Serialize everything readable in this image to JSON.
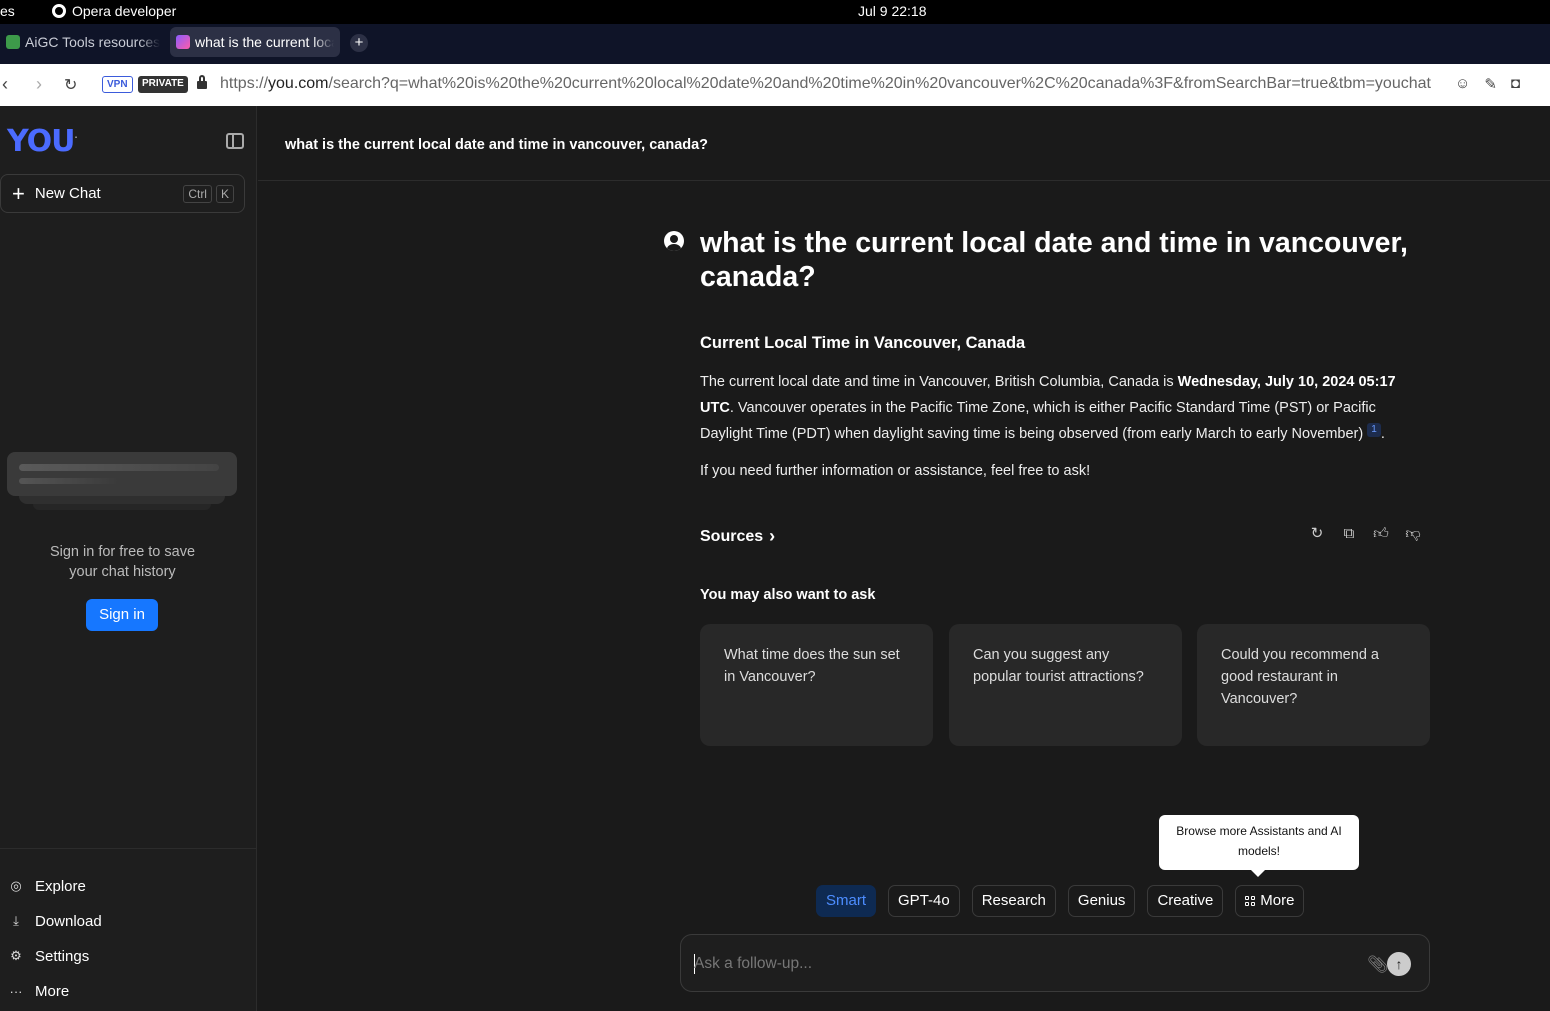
{
  "os": {
    "left_app": "es",
    "app_name": "Opera developer",
    "clock": "Jul 9  22:18"
  },
  "tabs": [
    {
      "title": "AiGC Tools resources"
    },
    {
      "title": "what is the current local date"
    }
  ],
  "address": {
    "vpn": "VPN",
    "private": "PRIVATE",
    "url_scheme": "https://",
    "url_host": "you.com",
    "url_path": "/search?q=what%20is%20the%20current%20local%20date%20and%20time%20in%20vancouver%2C%20canada%3F&fromSearchBar=true&tbm=youchat"
  },
  "sidebar": {
    "logo": "YOU",
    "new_chat": "New Chat",
    "shortcut": [
      "Ctrl",
      "K"
    ],
    "signin_msg_line1": "Sign in for free to save",
    "signin_msg_line2": "your chat history",
    "signin_btn": "Sign in",
    "nav": [
      {
        "label": "Explore",
        "icon": "compass-icon"
      },
      {
        "label": "Download",
        "icon": "download-icon"
      },
      {
        "label": "Settings",
        "icon": "gear-icon"
      },
      {
        "label": "More",
        "icon": "ellipsis-icon"
      }
    ]
  },
  "header": {
    "title": "what is the current local date and time in vancouver, canada?"
  },
  "chat": {
    "question": "what is the current local date and time in vancouver, canada?",
    "answer_heading": "Current Local Time in Vancouver, Canada",
    "answer_p1_pre": "The current local date and time in Vancouver, British Columbia, Canada is ",
    "answer_p1_bold": "Wednesday, July 10, 2024 05:17 UTC",
    "answer_p1_post": ". Vancouver operates in the Pacific Time Zone, which is either Pacific Standard Time (PST) or Pacific Daylight Time (PDT) when daylight saving time is being observed (from early March to early November) ",
    "citation": "1",
    "answer_p1_end": ".",
    "answer_p2": "If you need further information or assistance, feel free to ask!",
    "sources": "Sources",
    "ask_label": "You may also want to ask",
    "suggestions": [
      "What time does the sun set in Vancouver?",
      "Can you suggest any popular tourist attractions?",
      "Could you recommend a good restaurant in Vancouver?"
    ]
  },
  "tooltip": "Browse more Assistants and AI models!",
  "modes": [
    "Smart",
    "GPT-4o",
    "Research",
    "Genius",
    "Creative",
    "More"
  ],
  "composer": {
    "placeholder": "Ask a follow-up..."
  },
  "colors": {
    "accent": "#1677ff",
    "logo": "#4b6bff",
    "active_mode_bg": "#0e2a52",
    "active_mode_text": "#4d8dff"
  }
}
